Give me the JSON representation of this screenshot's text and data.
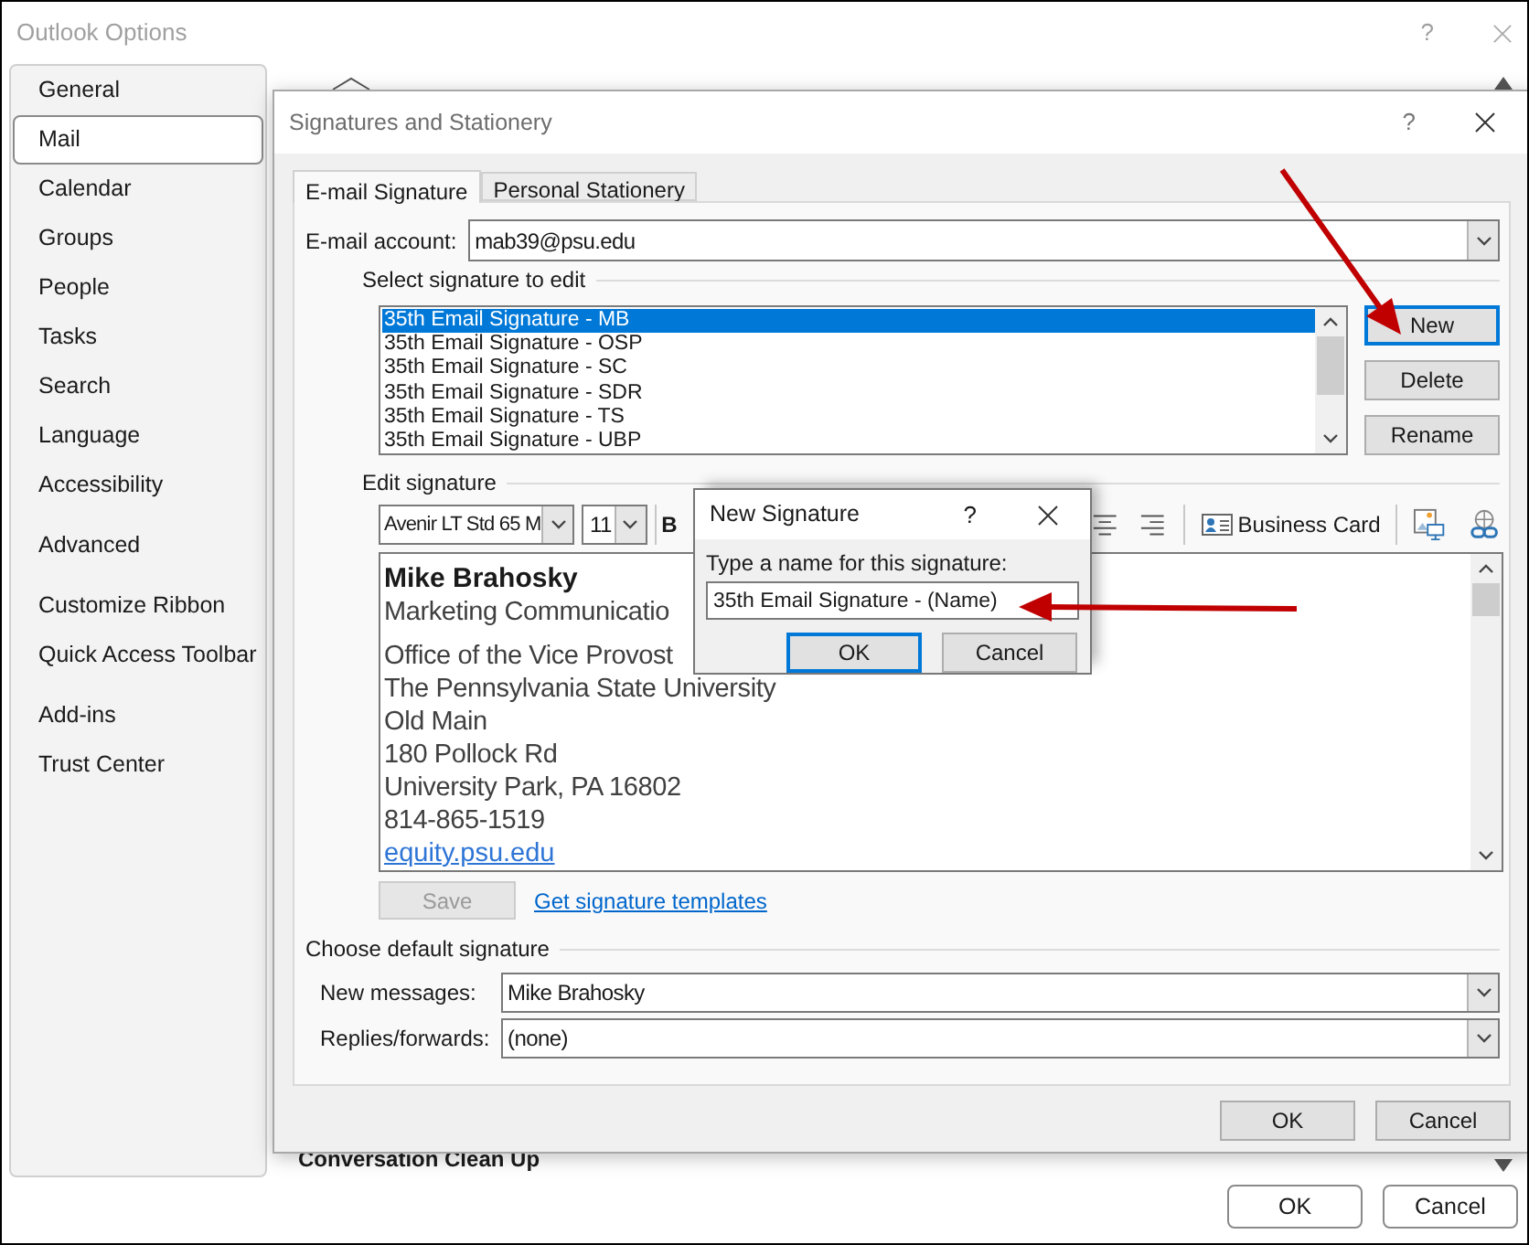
{
  "window": {
    "title": "Outlook Options",
    "help": "?"
  },
  "sidebar": {
    "groups": [
      [
        {
          "label": "General",
          "selected": false
        },
        {
          "label": "Mail",
          "selected": true
        },
        {
          "label": "Calendar",
          "selected": false
        },
        {
          "label": "Groups",
          "selected": false
        },
        {
          "label": "People",
          "selected": false
        },
        {
          "label": "Tasks",
          "selected": false
        },
        {
          "label": "Search",
          "selected": false
        },
        {
          "label": "Language",
          "selected": false
        },
        {
          "label": "Accessibility",
          "selected": false
        }
      ],
      [
        {
          "label": "Advanced",
          "selected": false
        }
      ],
      [
        {
          "label": "Customize Ribbon",
          "selected": false
        },
        {
          "label": "Quick Access Toolbar",
          "selected": false
        }
      ],
      [
        {
          "label": "Add-ins",
          "selected": false
        },
        {
          "label": "Trust Center",
          "selected": false
        }
      ]
    ]
  },
  "background_section": {
    "heading": "Conversation Clean Up"
  },
  "footer_buttons": [
    "OK",
    "Cancel"
  ],
  "signatures_dialog": {
    "title": "Signatures and Stationery",
    "help": "?",
    "tabs": [
      {
        "label": "E-mail Signature",
        "selected": true
      },
      {
        "label": "Personal Stationery",
        "selected": false
      }
    ],
    "account_label": "E-mail account:",
    "account": "mab39@psu.edu",
    "select_heading": "Select signature to edit",
    "signatures": [
      {
        "label": "35th Email Signature - MB",
        "selected": true
      },
      {
        "label": "35th Email Signature - OSP",
        "selected": false
      },
      {
        "label": "35th Email Signature - SC",
        "selected": false
      },
      {
        "label": "35th Email Signature - SDR",
        "selected": false
      },
      {
        "label": "35th Email Signature - TS",
        "selected": false
      },
      {
        "label": "35th Email Signature - UBP",
        "selected": false
      }
    ],
    "list_buttons": [
      {
        "label": "New",
        "focused": true
      },
      {
        "label": "Delete",
        "focused": false
      },
      {
        "label": "Rename",
        "focused": false
      }
    ],
    "edit_heading": "Edit signature",
    "toolbar": {
      "font": "Avenir LT Std 65 M",
      "size": "11",
      "bold": "B",
      "business_card": "Business Card"
    },
    "signature_lines": [
      {
        "kind": "name",
        "text": "Mike Brahosky"
      },
      {
        "kind": "text",
        "text": "Marketing Communicatio"
      },
      {
        "kind": "blank"
      },
      {
        "kind": "text",
        "text": "Office of the Vice Provost"
      },
      {
        "kind": "text",
        "text": "The Pennsylvania State University"
      },
      {
        "kind": "text",
        "text": "Old Main"
      },
      {
        "kind": "text",
        "text": "180 Pollock Rd"
      },
      {
        "kind": "text",
        "text": "University Park, PA 16802"
      },
      {
        "kind": "text",
        "text": "814-865-1519"
      },
      {
        "kind": "link",
        "text": "equity.psu.edu"
      }
    ],
    "save": {
      "label": "Save",
      "disabled": true
    },
    "templates_link": "Get signature templates",
    "default_heading": "Choose default signature",
    "defaults": [
      {
        "label": "New messages:",
        "value": "Mike Brahosky"
      },
      {
        "label": "Replies/forwards:",
        "value": "(none)"
      }
    ],
    "buttons": [
      "OK",
      "Cancel"
    ]
  },
  "new_signature_dialog": {
    "title": "New Signature",
    "help": "?",
    "prompt": "Type a name for this signature:",
    "value": "35th Email Signature - (Name)",
    "buttons": [
      {
        "label": "OK",
        "focused": true
      },
      {
        "label": "Cancel",
        "focused": false
      }
    ]
  }
}
